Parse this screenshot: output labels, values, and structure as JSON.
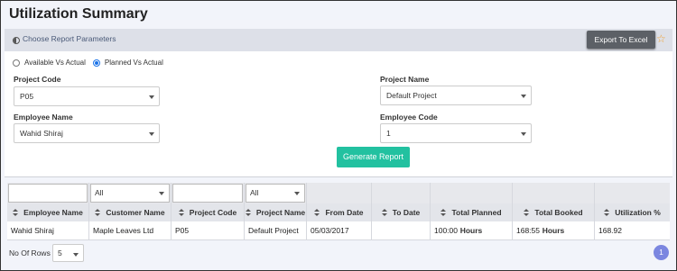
{
  "page": {
    "title": "Utilization Summary"
  },
  "params": {
    "label": "Choose Report Parameters",
    "export_label": "Export To Excel"
  },
  "report_type": {
    "options": [
      "Available Vs Actual",
      "Planned Vs Actual"
    ],
    "selected": "Planned Vs Actual"
  },
  "fields": {
    "project_code": {
      "label": "Project Code",
      "value": "P05"
    },
    "project_name": {
      "label": "Project Name",
      "value": "Default Project"
    },
    "employee_name": {
      "label": "Employee Name",
      "value": "Wahid Shiraj"
    },
    "employee_code": {
      "label": "Employee Code",
      "value": "1"
    }
  },
  "generate_label": "Generate Report",
  "grid": {
    "filters": [
      "",
      "All",
      "",
      "All",
      "",
      "",
      "",
      "",
      ""
    ],
    "columns": [
      "Employee Name",
      "Customer Name",
      "Project Code",
      "Project Name",
      "From Date",
      "To Date",
      "Total Planned Hours",
      "Total Booked Hours",
      "Utilization %"
    ],
    "rows": [
      [
        "Wahid Shiraj",
        "Maple Leaves Ltd",
        "P05",
        "Default Project",
        "05/03/2017",
        "",
        "100:00",
        "168:55",
        "168.92"
      ]
    ]
  },
  "pagination": {
    "rows_label": "No Of Rows :",
    "rows_value": "5",
    "current_page": "1"
  },
  "colors": {
    "accent": "#22c1a0",
    "export_bg": "#5c6066",
    "page_btn": "#7b86e0",
    "star": "#f0a030"
  }
}
